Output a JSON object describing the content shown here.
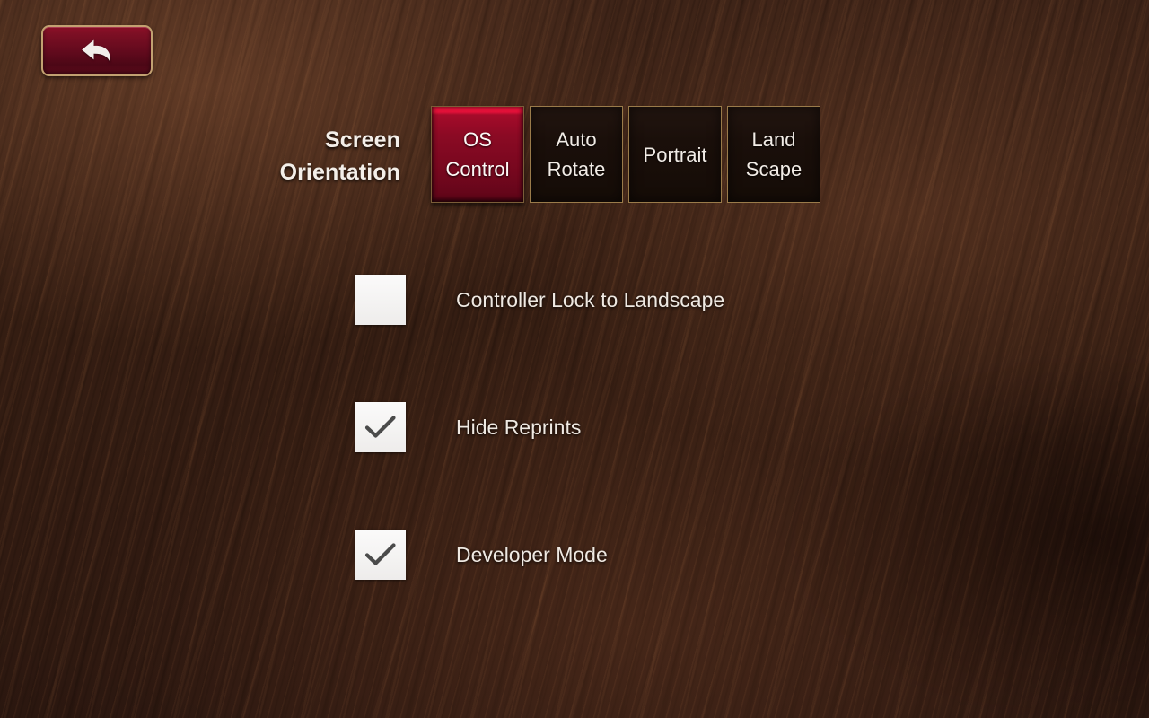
{
  "theme": {
    "background_color": "#341d12",
    "accent_red": "#8b0a24",
    "accent_red_highlight": "#f0173f",
    "border_gold": "#9a7b4a",
    "text_color": "#efe9e2",
    "checkbox_fill": "#f6f5f4",
    "checkmark_color": "#4b4b4b"
  },
  "back_button": {
    "icon": "back-arrow-icon",
    "label": ""
  },
  "orientation": {
    "label": "Screen\nOrientation",
    "options": [
      {
        "label": "OS\nControl",
        "selected": true
      },
      {
        "label": "Auto\nRotate",
        "selected": false
      },
      {
        "label": "Portrait",
        "selected": false
      },
      {
        "label": "Land\nScape",
        "selected": false
      }
    ]
  },
  "settings": {
    "rows": [
      {
        "label": "Controller Lock to Landscape",
        "checked": false
      },
      {
        "label": "Hide Reprints",
        "checked": true
      },
      {
        "label": "Developer Mode",
        "checked": true
      }
    ]
  }
}
